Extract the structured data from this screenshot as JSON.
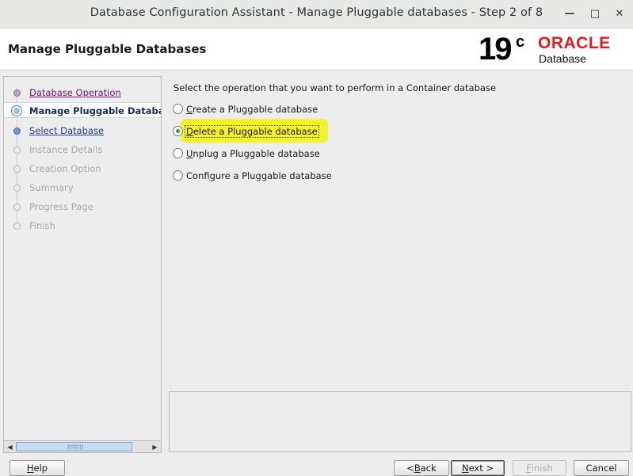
{
  "window": {
    "title": "Database Configuration Assistant - Manage Pluggable databases - Step 2 of 8",
    "minimize_glyph": "—",
    "maximize_glyph": "□",
    "close_glyph": "✕"
  },
  "header": {
    "page_title": "Manage Pluggable Databases",
    "logo": {
      "version": "19",
      "version_suffix": "c",
      "brand": "ORACLE",
      "product": "Database",
      "brand_color": "#e21a22"
    }
  },
  "nav": {
    "items": [
      {
        "label": "Database Operation",
        "state": "visited"
      },
      {
        "label": "Manage Pluggable Databases",
        "state": "current"
      },
      {
        "label": "Select Database",
        "state": "link"
      },
      {
        "label": "Instance Details",
        "state": "disabled"
      },
      {
        "label": "Creation Option",
        "state": "disabled"
      },
      {
        "label": "Summary",
        "state": "disabled"
      },
      {
        "label": "Progress Page",
        "state": "disabled"
      },
      {
        "label": "Finish",
        "state": "disabled"
      }
    ]
  },
  "main": {
    "prompt": "Select the operation that you want to perform in a Container database",
    "options": [
      {
        "mnemonic": "C",
        "rest": "reate a Pluggable database",
        "selected": false
      },
      {
        "mnemonic": "D",
        "rest": "elete a Pluggable database",
        "selected": true
      },
      {
        "mnemonic": "U",
        "rest": "nplug a Pluggable database",
        "selected": false
      },
      {
        "pre": "Confi",
        "mnemonic": "g",
        "rest": "ure a Pluggable database",
        "selected": false
      }
    ]
  },
  "buttons": {
    "help": {
      "mnemonic": "H",
      "rest": "elp"
    },
    "back": {
      "pre": "< ",
      "mnemonic": "B",
      "rest": "ack"
    },
    "next": {
      "mnemonic": "N",
      "rest": "ext >"
    },
    "finish": {
      "mnemonic": "F",
      "rest": "inish"
    },
    "cancel": {
      "label": "Cancel"
    }
  },
  "colors": {
    "highlight": "#f3f21a",
    "selected_radio": "#3c9a3c"
  }
}
